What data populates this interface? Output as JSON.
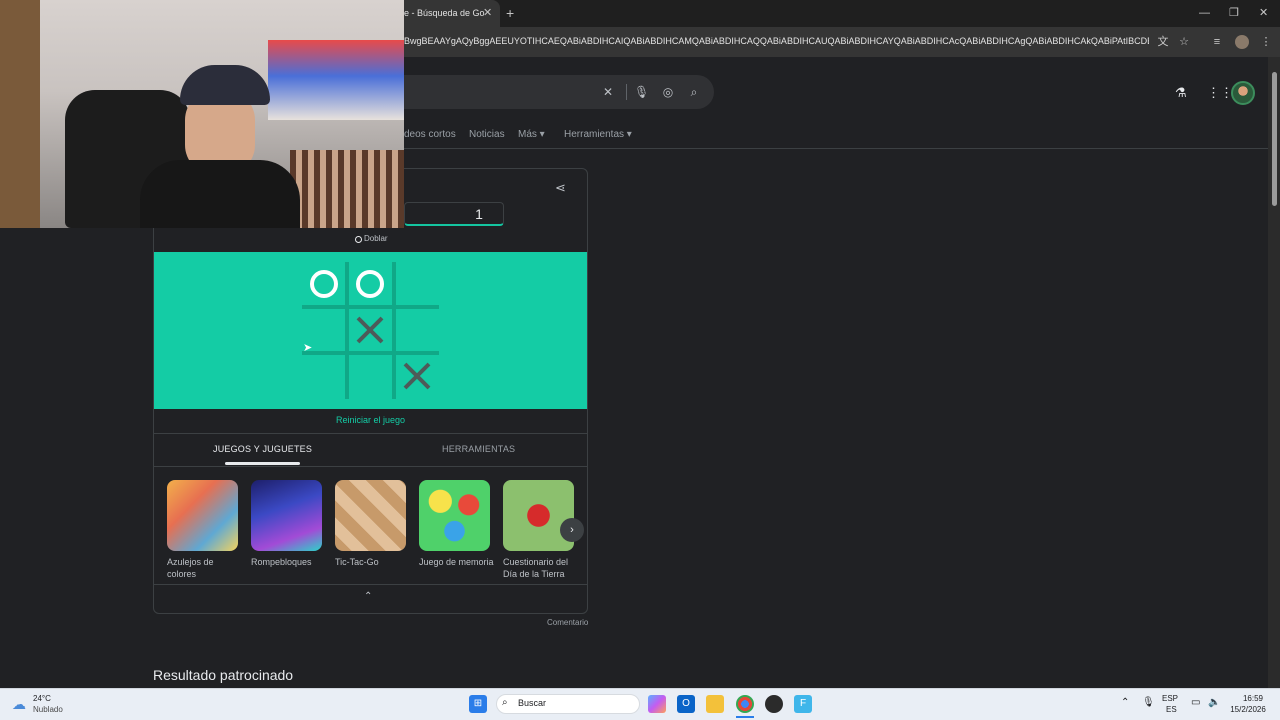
{
  "browser": {
    "tab_title": "e - Búsqueda de Go",
    "url": "BwgBEAAYgAQyBggAEEUYOTIHCAEQABiABDIHCAIQABiABDIHCAMQABiABDIHCAQQABiABDIHCAUQABiABDIHCAYQABiABDIHCAcQABiABDIHCAgQABiABDIHCAkQABiPAtIBCDE3M..."
  },
  "search": {
    "nav_links": [
      "deos cortos",
      "Noticias",
      "Más",
      "Herramientas"
    ]
  },
  "game": {
    "score": "1",
    "mode_label": "Doblar",
    "board": [
      "O",
      "O",
      "",
      "",
      "X",
      "",
      "",
      "",
      "X"
    ],
    "restart_label": "Reiniciar el juego",
    "tabs": [
      "JUEGOS Y JUGUETES",
      "HERRAMIENTAS"
    ],
    "carousel": [
      {
        "name": "Azulejos de colores",
        "icon": "tiles-thumbnail"
      },
      {
        "name": "Rompebloques",
        "icon": "breakout-thumbnail"
      },
      {
        "name": "Tic-Tac-Go",
        "icon": "tictactoe-thumbnail"
      },
      {
        "name": "Juego de memoria",
        "icon": "memory-thumbnail"
      },
      {
        "name": "Cuestionario del Día de la Tierra",
        "icon": "ladybug-thumbnail"
      }
    ],
    "feedback": "Comentario"
  },
  "sponsored_heading": "Resultado patrocinado",
  "taskbar": {
    "weather_temp": "24°C",
    "weather_desc": "Nublado",
    "search_placeholder": "Buscar",
    "lang_top": "ESP",
    "lang_bottom": "ES",
    "time": "16:59",
    "date": "15/2/2026"
  },
  "colors": {
    "board": "#14cca5",
    "page_bg": "#202124"
  }
}
